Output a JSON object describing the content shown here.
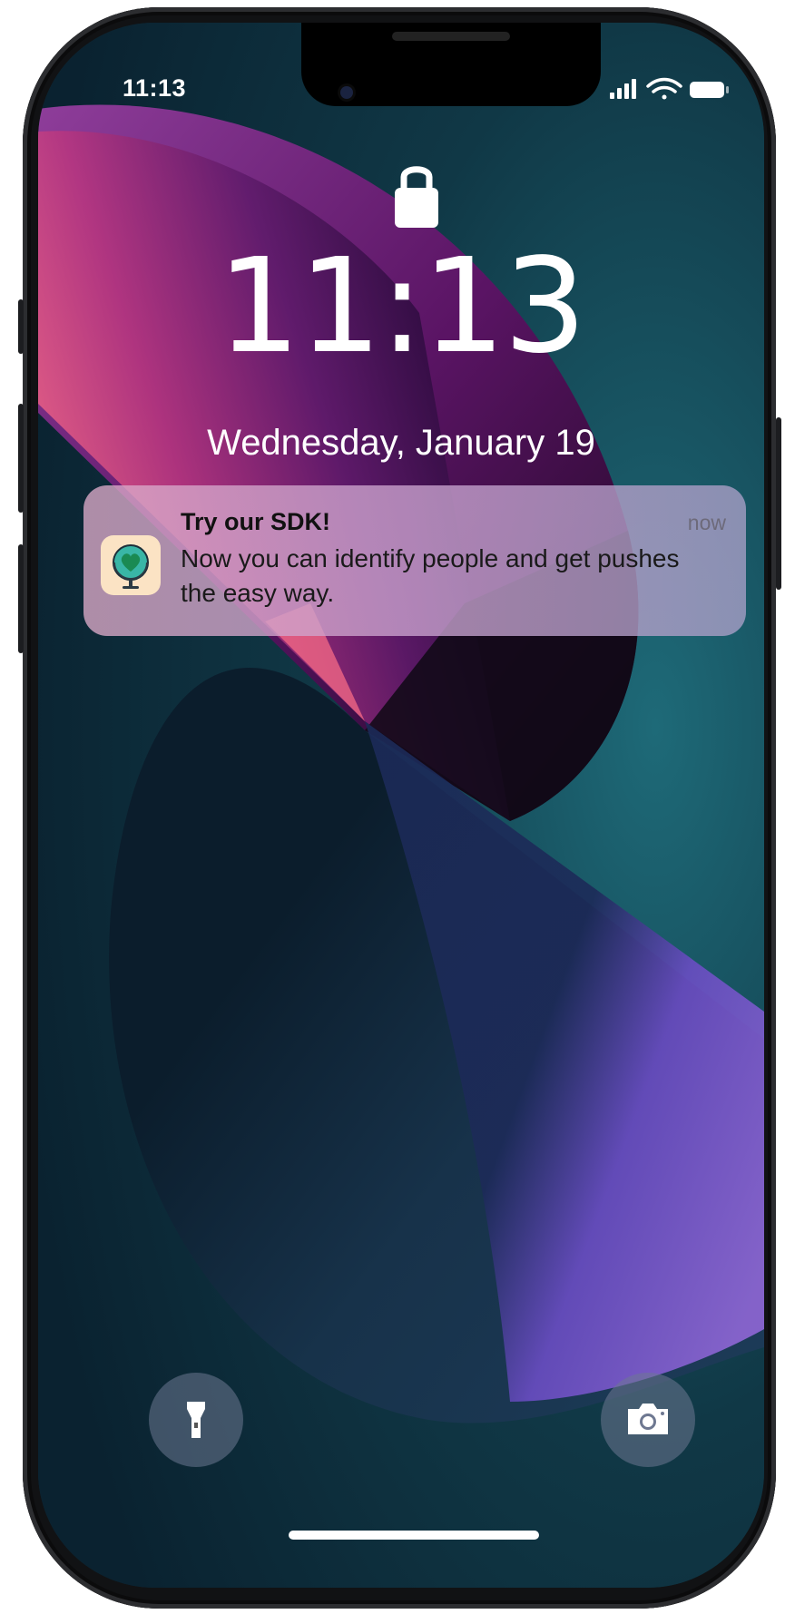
{
  "status_bar": {
    "time": "11:13",
    "icons": [
      "cellular-signal-icon",
      "wifi-icon",
      "battery-icon"
    ]
  },
  "lock_screen": {
    "lock_icon": "lock-icon",
    "clock": "11:13",
    "date": "Wednesday, January 19"
  },
  "notification": {
    "app_icon": "globe-heart-icon",
    "title": "Try our SDK!",
    "body": "Now you can identify people and get pushes the easy way.",
    "time": "now"
  },
  "quick_actions": {
    "left": "flashlight-icon",
    "right": "camera-icon"
  },
  "colors": {
    "background": "#0f2a36",
    "notification_bg": "#cfa9cc",
    "accent_purple": "#7a4fc4",
    "accent_pink": "#f06a86"
  }
}
